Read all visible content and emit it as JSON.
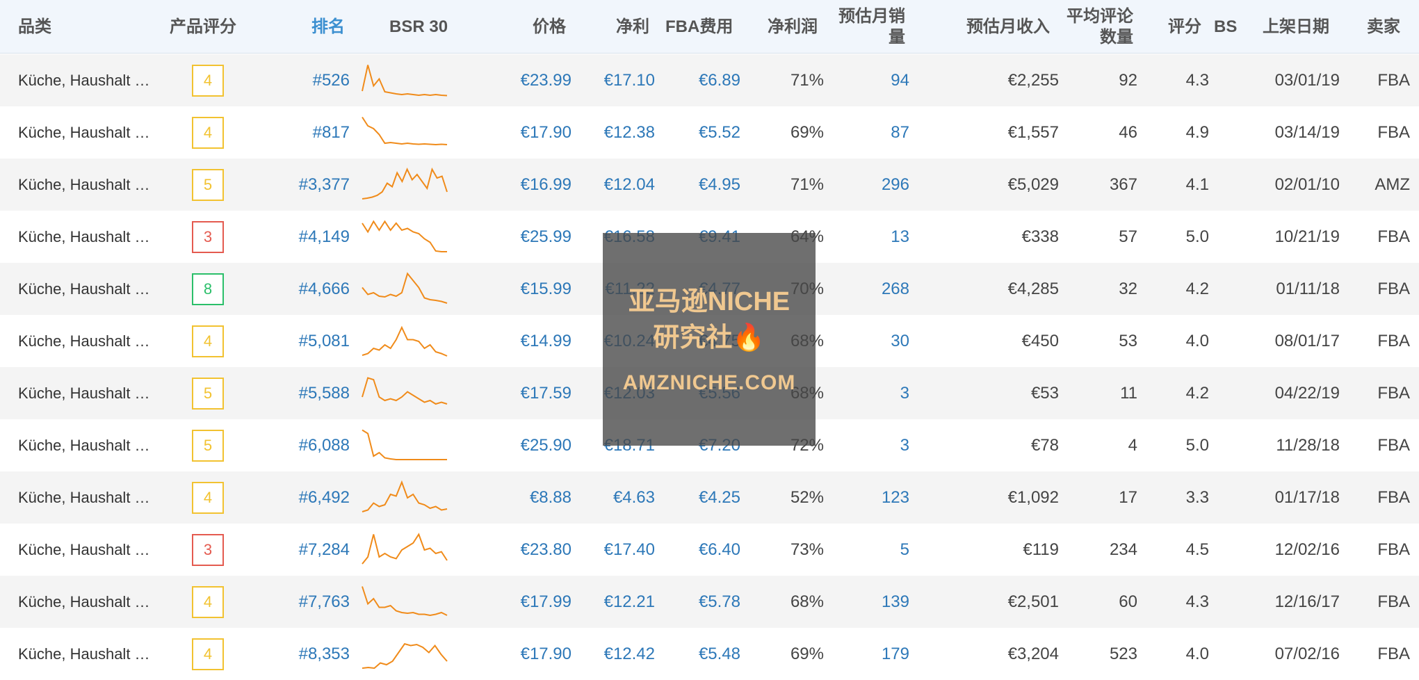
{
  "colors": {
    "accent_blue": "#2d78b8",
    "header_bg": "#f1f6fc",
    "spark_orange": "#f08b1a",
    "score_yellow": "#f2c230",
    "score_red": "#e45a4f",
    "score_green": "#2bbf6a"
  },
  "headers": {
    "category": "品类",
    "product_score": "产品评分",
    "rank": "排名",
    "bsr30": "BSR 30",
    "price": "价格",
    "net": "净利",
    "fba_fee": "FBA费用",
    "net_margin": "净利润",
    "est_monthly_sales": "预估月销量",
    "est_monthly_revenue": "预估月收入",
    "avg_reviews": "平均评论数量",
    "rating": "评分",
    "bs": "BS",
    "listed_date": "上架日期",
    "seller": "卖家"
  },
  "rows": [
    {
      "category": "Küche, Haushalt …",
      "score": "4",
      "score_color": "yellow",
      "rank": "#526",
      "spark": [
        0.2,
        0.95,
        0.35,
        0.55,
        0.18,
        0.15,
        0.12,
        0.1,
        0.12,
        0.1,
        0.08,
        0.1,
        0.08,
        0.1,
        0.08,
        0.07
      ],
      "price": "€23.99",
      "net": "€17.10",
      "fba": "€6.89",
      "margin": "71%",
      "sales": "94",
      "revenue": "€2,255",
      "reviews": "92",
      "rating": "4.3",
      "date": "03/01/19",
      "seller": "FBA"
    },
    {
      "category": "Küche, Haushalt …",
      "score": "4",
      "score_color": "yellow",
      "rank": "#817",
      "spark": [
        0.95,
        0.7,
        0.62,
        0.45,
        0.2,
        0.22,
        0.2,
        0.18,
        0.2,
        0.18,
        0.17,
        0.18,
        0.17,
        0.16,
        0.17,
        0.16
      ],
      "price": "€17.90",
      "net": "€12.38",
      "fba": "€5.52",
      "margin": "69%",
      "sales": "87",
      "revenue": "€1,557",
      "reviews": "46",
      "rating": "4.9",
      "date": "03/14/19",
      "seller": "FBA"
    },
    {
      "category": "Küche, Haushalt …",
      "score": "5",
      "score_color": "yellow",
      "rank": "#3,377",
      "spark": [
        0.1,
        0.12,
        0.15,
        0.2,
        0.3,
        0.55,
        0.45,
        0.85,
        0.6,
        0.95,
        0.65,
        0.8,
        0.6,
        0.4,
        0.95,
        0.7,
        0.75,
        0.3
      ],
      "price": "€16.99",
      "net": "€12.04",
      "fba": "€4.95",
      "margin": "71%",
      "sales": "296",
      "revenue": "€5,029",
      "reviews": "367",
      "rating": "4.1",
      "date": "02/01/10",
      "seller": "AMZ"
    },
    {
      "category": "Küche, Haushalt …",
      "score": "3",
      "score_color": "red",
      "rank": "#4,149",
      "spark": [
        0.9,
        0.65,
        0.95,
        0.7,
        0.95,
        0.7,
        0.9,
        0.7,
        0.75,
        0.65,
        0.6,
        0.45,
        0.35,
        0.1,
        0.08,
        0.08
      ],
      "price": "€25.99",
      "net": "€16.58",
      "fba": "€9.41",
      "margin": "64%",
      "sales": "13",
      "revenue": "€338",
      "reviews": "57",
      "rating": "5.0",
      "date": "10/21/19",
      "seller": "FBA"
    },
    {
      "category": "Küche, Haushalt …",
      "score": "8",
      "score_color": "green",
      "rank": "#4,666",
      "spark": [
        0.55,
        0.35,
        0.4,
        0.3,
        0.28,
        0.35,
        0.3,
        0.4,
        0.95,
        0.75,
        0.55,
        0.25,
        0.2,
        0.18,
        0.15,
        0.1
      ],
      "price": "€15.99",
      "net": "€11.22",
      "fba": "€4.77",
      "margin": "70%",
      "sales": "268",
      "revenue": "€4,285",
      "reviews": "32",
      "rating": "4.2",
      "date": "01/11/18",
      "seller": "FBA"
    },
    {
      "category": "Küche, Haushalt …",
      "score": "4",
      "score_color": "yellow",
      "rank": "#5,081",
      "spark": [
        0.1,
        0.15,
        0.3,
        0.25,
        0.4,
        0.3,
        0.55,
        0.9,
        0.55,
        0.55,
        0.5,
        0.3,
        0.4,
        0.2,
        0.15,
        0.08
      ],
      "price": "€14.99",
      "net": "€10.24",
      "fba": "€4.75",
      "margin": "68%",
      "sales": "30",
      "revenue": "€450",
      "reviews": "53",
      "rating": "4.0",
      "date": "08/01/17",
      "seller": "FBA"
    },
    {
      "category": "Küche, Haushalt …",
      "score": "5",
      "score_color": "yellow",
      "rank": "#5,588",
      "spark": [
        0.4,
        0.95,
        0.9,
        0.4,
        0.3,
        0.35,
        0.3,
        0.4,
        0.55,
        0.45,
        0.35,
        0.25,
        0.3,
        0.2,
        0.25,
        0.2
      ],
      "price": "€17.59",
      "net": "€12.03",
      "fba": "€5.56",
      "margin": "68%",
      "sales": "3",
      "revenue": "€53",
      "reviews": "11",
      "rating": "4.2",
      "date": "04/22/19",
      "seller": "FBA"
    },
    {
      "category": "Küche, Haushalt …",
      "score": "5",
      "score_color": "yellow",
      "rank": "#6,088",
      "spark": [
        0.95,
        0.85,
        0.2,
        0.3,
        0.15,
        0.12,
        0.1,
        0.1,
        0.1,
        0.1,
        0.1,
        0.1,
        0.1,
        0.1,
        0.1,
        0.1
      ],
      "price": "€25.90",
      "net": "€18.71",
      "fba": "€7.20",
      "margin": "72%",
      "sales": "3",
      "revenue": "€78",
      "reviews": "4",
      "rating": "5.0",
      "date": "11/28/18",
      "seller": "FBA"
    },
    {
      "category": "Küche, Haushalt …",
      "score": "4",
      "score_color": "yellow",
      "rank": "#6,492",
      "spark": [
        0.1,
        0.15,
        0.35,
        0.25,
        0.3,
        0.6,
        0.55,
        0.95,
        0.5,
        0.6,
        0.35,
        0.3,
        0.2,
        0.25,
        0.15,
        0.18
      ],
      "price": "€8.88",
      "net": "€4.63",
      "fba": "€4.25",
      "margin": "52%",
      "sales": "123",
      "revenue": "€1,092",
      "reviews": "17",
      "rating": "3.3",
      "date": "01/17/18",
      "seller": "FBA"
    },
    {
      "category": "Küche, Haushalt …",
      "score": "3",
      "score_color": "red",
      "rank": "#7,284",
      "spark": [
        0.1,
        0.3,
        0.95,
        0.3,
        0.4,
        0.3,
        0.25,
        0.5,
        0.6,
        0.7,
        0.95,
        0.5,
        0.55,
        0.4,
        0.45,
        0.2
      ],
      "price": "€23.80",
      "net": "€17.40",
      "fba": "€6.40",
      "margin": "73%",
      "sales": "5",
      "revenue": "€119",
      "reviews": "234",
      "rating": "4.5",
      "date": "12/02/16",
      "seller": "FBA"
    },
    {
      "category": "Küche, Haushalt …",
      "score": "4",
      "score_color": "yellow",
      "rank": "#7,763",
      "spark": [
        0.95,
        0.45,
        0.6,
        0.35,
        0.35,
        0.4,
        0.25,
        0.2,
        0.18,
        0.2,
        0.15,
        0.15,
        0.12,
        0.15,
        0.2,
        0.12
      ],
      "price": "€17.99",
      "net": "€12.21",
      "fba": "€5.78",
      "margin": "68%",
      "sales": "139",
      "revenue": "€2,501",
      "reviews": "60",
      "rating": "4.3",
      "date": "12/16/17",
      "seller": "FBA"
    },
    {
      "category": "Küche, Haushalt …",
      "score": "4",
      "score_color": "yellow",
      "rank": "#8,353",
      "spark": [
        0.1,
        0.12,
        0.1,
        0.25,
        0.2,
        0.3,
        0.55,
        0.8,
        0.75,
        0.78,
        0.7,
        0.55,
        0.75,
        0.5,
        0.3
      ],
      "price": "€17.90",
      "net": "€12.42",
      "fba": "€5.48",
      "margin": "69%",
      "sales": "179",
      "revenue": "€3,204",
      "reviews": "523",
      "rating": "4.0",
      "date": "07/02/16",
      "seller": "FBA"
    }
  ],
  "watermark": {
    "line1": "亚马逊NICHE",
    "line2": "研究社🔥",
    "line3": "AMZNICHE.COM"
  }
}
